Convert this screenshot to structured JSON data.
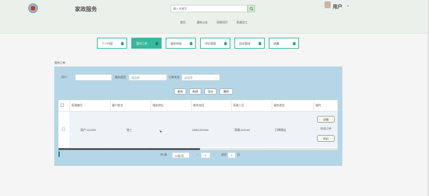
{
  "header": {
    "site_title": "家政服务",
    "search_placeholder": "输入关键字",
    "user_label": "用户",
    "nav": [
      "首页",
      "通知公告",
      "家政项目",
      "家政员工"
    ]
  },
  "tabs": [
    {
      "label": "个人内容"
    },
    {
      "label": "我的订单"
    },
    {
      "label": "服务申请"
    },
    {
      "label": "评价管理"
    },
    {
      "label": "投诉管理"
    },
    {
      "label": "收藏"
    }
  ],
  "section_label": "我的订单",
  "filters": {
    "user_label": "用户:",
    "user_value": "",
    "service_type_label": "服务类型:",
    "service_type_value": "请选择",
    "status_label": "订单状态:",
    "status_value": "请选择"
  },
  "buttons": [
    "查询",
    "新增",
    "导出",
    "删除"
  ],
  "table": {
    "headers": [
      "",
      "家政编号",
      "客户姓名",
      "服务地址",
      "联系电话",
      "家政人员",
      "服务类型",
      "操作"
    ],
    "rows": [
      {
        "id": "",
        "code": "用户-112233",
        "name": "张三",
        "address": "",
        "phone": "13811223344",
        "worker": "家政-221144",
        "type": "日常保洁",
        "actions": [
          "详情",
          "修改订单",
          "评价"
        ]
      }
    ]
  },
  "pagination": {
    "total_text": "共1条",
    "page_size": "10条/页",
    "prev": "<",
    "current": "1",
    "next": ">",
    "goto_label": "前往",
    "goto_value": "1",
    "goto_suffix": "页"
  }
}
